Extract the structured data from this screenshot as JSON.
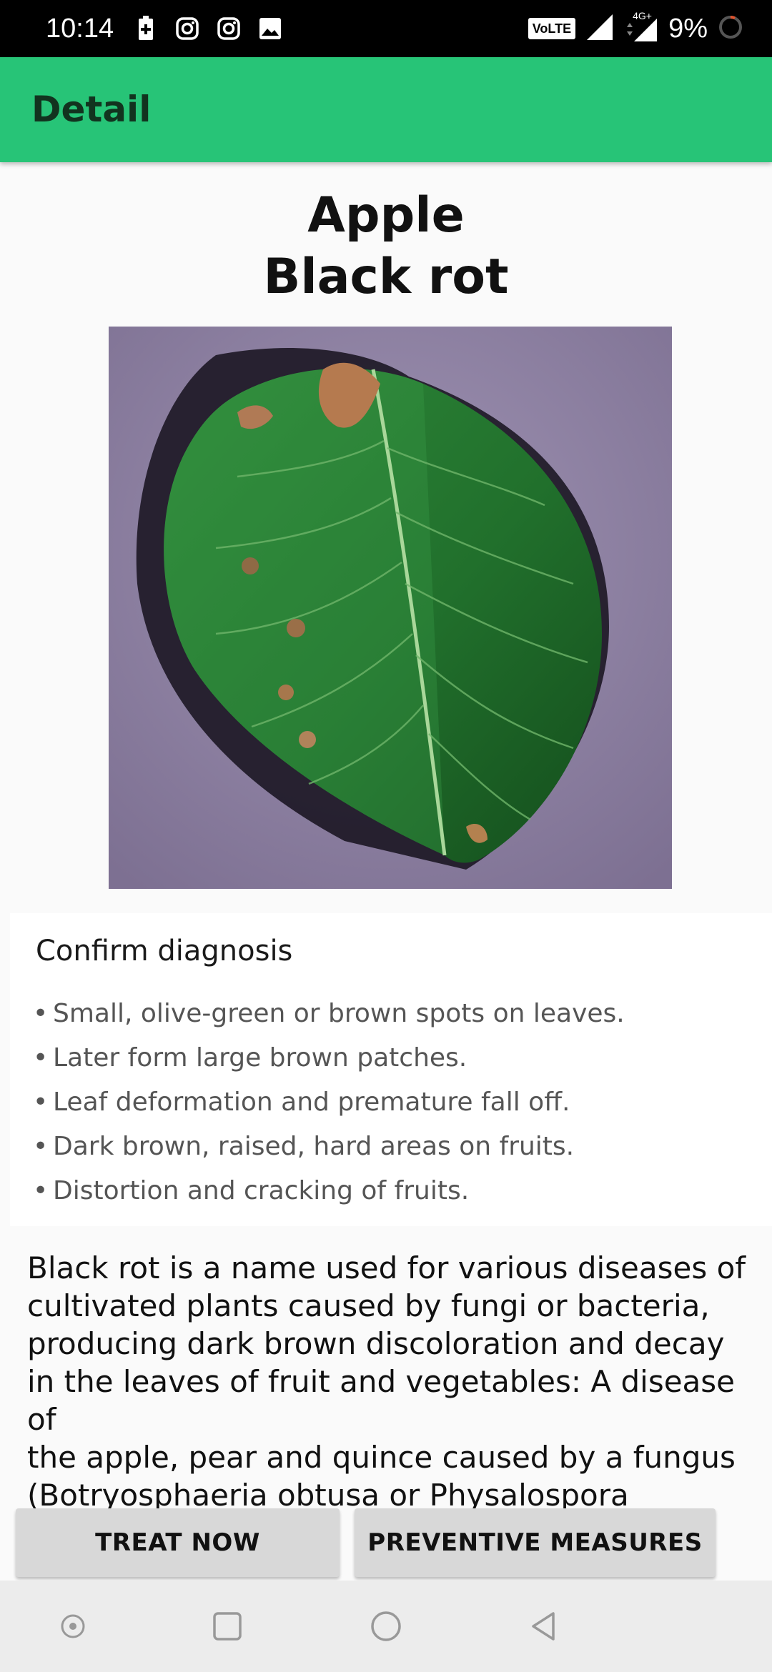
{
  "status_bar": {
    "time": "10:14",
    "network_badge": "VoLTE",
    "network_type": "4G+",
    "battery_percent": "9%"
  },
  "app_bar": {
    "title": "Detail"
  },
  "disease": {
    "plant": "Apple",
    "name": "Black rot"
  },
  "card": {
    "heading": "Confirm diagnosis",
    "bullet_char": "•",
    "symptoms": [
      "Small, olive-green or brown spots on leaves.",
      "Later form large brown patches.",
      "Leaf deformation and premature fall off.",
      "Dark brown, raised, hard areas on fruits.",
      "Distortion and cracking of fruits."
    ]
  },
  "description": {
    "lines": [
      "Black rot is a name used for various diseases of",
      "cultivated plants caused by fungi or bacteria,",
      "producing dark brown discoloration and decay",
      "in the leaves of fruit and vegetables: A disease of",
      "the apple, pear and quince caused by a fungus",
      "(Botryosphaeria obtusa or Physalospora cydoniae)"
    ]
  },
  "buttons": {
    "treat": "TREAT NOW",
    "prevent": "PREVENTIVE MEASURES"
  },
  "colors": {
    "app_bar": "#27c477",
    "button_bg": "#d8d8d8"
  }
}
